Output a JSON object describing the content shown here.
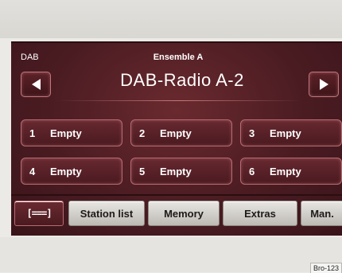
{
  "radio": {
    "source_label": "DAB",
    "ensemble": "Ensemble A",
    "station": "DAB-Radio A-2",
    "prev_icon": "triangle-left-icon",
    "next_icon": "triangle-right-icon"
  },
  "presets": [
    {
      "number": "1",
      "label": "Empty"
    },
    {
      "number": "2",
      "label": "Empty"
    },
    {
      "number": "3",
      "label": "Empty"
    },
    {
      "number": "4",
      "label": "Empty"
    },
    {
      "number": "5",
      "label": "Empty"
    },
    {
      "number": "6",
      "label": "Empty"
    }
  ],
  "softkeys": {
    "menu_glyph": "[===]",
    "station_list": "Station list",
    "memory": "Memory",
    "extras": "Extras",
    "manual": "Man."
  },
  "figure_code": "Bro-123",
  "colors": {
    "screen_background": "#4a1c22",
    "button_border": "#b96a72",
    "softkey_background": "#d8d5d0"
  }
}
